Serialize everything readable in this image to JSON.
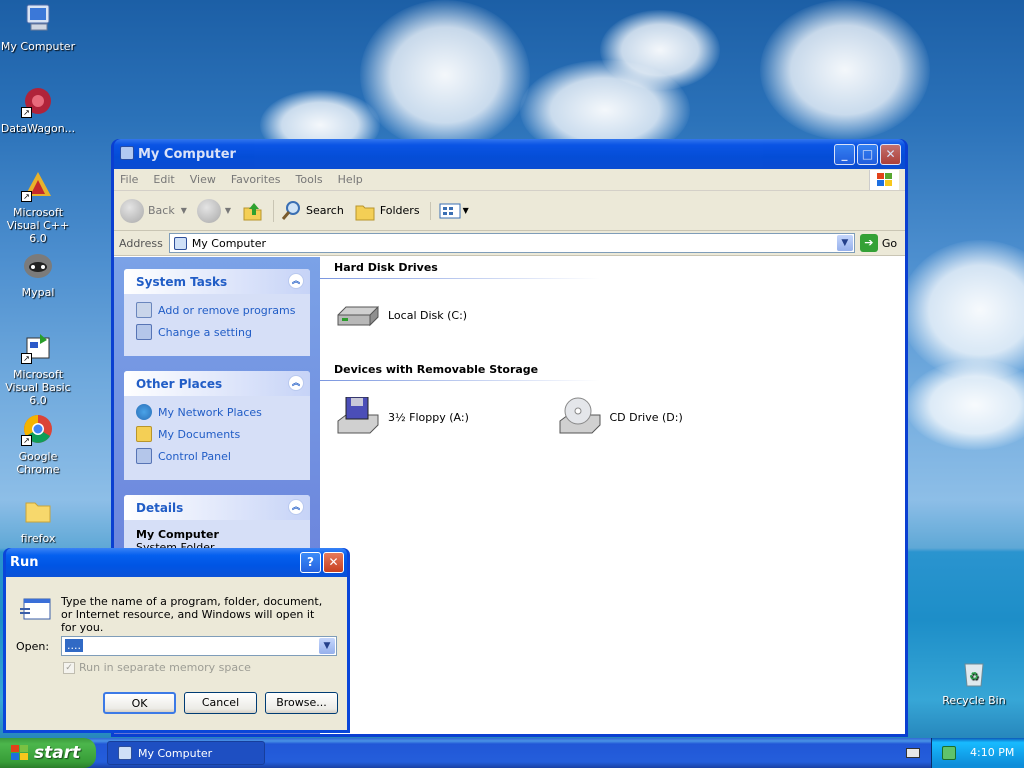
{
  "desktop": {
    "icons": [
      {
        "label": "My Computer",
        "icon": "computer-icon"
      },
      {
        "label": "DataWagon...",
        "icon": "datawagon-icon"
      },
      {
        "label": "Microsoft Visual C++ 6.0",
        "icon": "visual-cpp-icon"
      },
      {
        "label": "Mypal",
        "icon": "mypal-icon"
      },
      {
        "label": "Microsoft Visual Basic 6.0",
        "icon": "visual-basic-icon"
      },
      {
        "label": "Google Chrome",
        "icon": "chrome-icon"
      },
      {
        "label": "firefox",
        "icon": "folder-icon"
      },
      {
        "label": "Recycle Bin",
        "icon": "recycle-bin-icon"
      }
    ]
  },
  "window": {
    "title": "My Computer",
    "menu": [
      "File",
      "Edit",
      "View",
      "Favorites",
      "Tools",
      "Help"
    ],
    "toolbar": {
      "back": "Back",
      "search": "Search",
      "folders": "Folders"
    },
    "address": {
      "label": "Address",
      "value": "My Computer",
      "go": "Go"
    },
    "panels": [
      {
        "title": "System Tasks",
        "items": [
          "Add or remove programs",
          "Change a setting"
        ]
      },
      {
        "title": "Other Places",
        "items": [
          "My Network Places",
          "My Documents",
          "Control Panel"
        ]
      },
      {
        "title": "Details",
        "name": "My Computer",
        "type": "System Folder"
      }
    ],
    "sections": [
      {
        "title": "Hard Disk Drives",
        "items": [
          "Local Disk (C:)"
        ]
      },
      {
        "title": "Devices with Removable Storage",
        "items": [
          "3½ Floppy (A:)",
          "CD Drive (D:)"
        ]
      }
    ]
  },
  "run": {
    "title": "Run",
    "message": "Type the name of a program, folder, document, or Internet resource, and Windows will open it for you.",
    "open_label": "Open:",
    "open_value": "....",
    "checkbox_label": "Run in separate memory space",
    "checkbox_checked": true,
    "ok": "OK",
    "cancel": "Cancel",
    "browse": "Browse..."
  },
  "taskbar": {
    "start": "start",
    "task": "My Computer",
    "clock": "4:10 PM"
  },
  "colors": {
    "xp_blue": "#0a46d9",
    "panel_text": "#215dc6",
    "start_green": "#379d37"
  }
}
